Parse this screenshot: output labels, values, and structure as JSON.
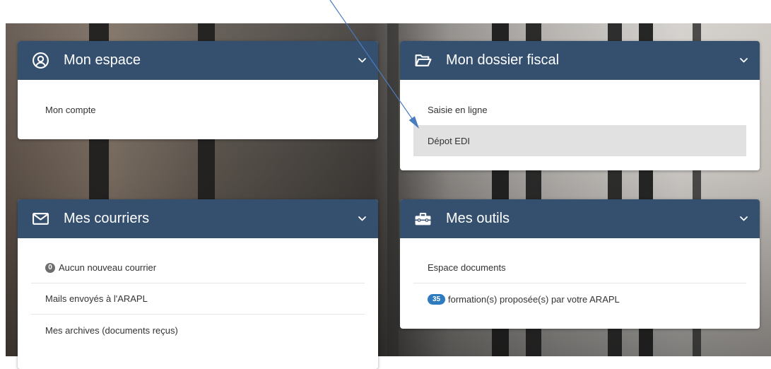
{
  "cards": [
    {
      "title": "Mon espace",
      "icon": "user-circle-icon",
      "items": [
        {
          "label": "Mon compte"
        }
      ]
    },
    {
      "title": "Mon dossier fiscal",
      "icon": "folder-open-icon",
      "items": [
        {
          "label": "Saisie en ligne"
        },
        {
          "label": "Dépot EDI",
          "highlighted": true
        }
      ]
    },
    {
      "title": "Mes courriers",
      "icon": "envelope-icon",
      "items": [
        {
          "badge": "0",
          "label": "Aucun nouveau courrier"
        },
        {
          "label": "Mails envoyés à l'ARAPL"
        },
        {
          "label": "Mes archives (documents reçus)"
        }
      ]
    },
    {
      "title": "Mes outils",
      "icon": "toolbox-icon",
      "items": [
        {
          "label": "Espace documents"
        },
        {
          "badge": "35",
          "label": "formation(s) proposée(s) par votre ARAPL"
        }
      ]
    }
  ],
  "header_toggle_icon": "chevron-down-icon",
  "annotation": {
    "type": "arrow",
    "points_to": "Dépot EDI"
  },
  "colors": {
    "header": "#34506e",
    "highlight": "#e1e1e1",
    "badge_gray": "#6e6e6e",
    "badge_blue": "#2e7bbf",
    "arrow": "#4a7cc0",
    "text": "#333333"
  }
}
